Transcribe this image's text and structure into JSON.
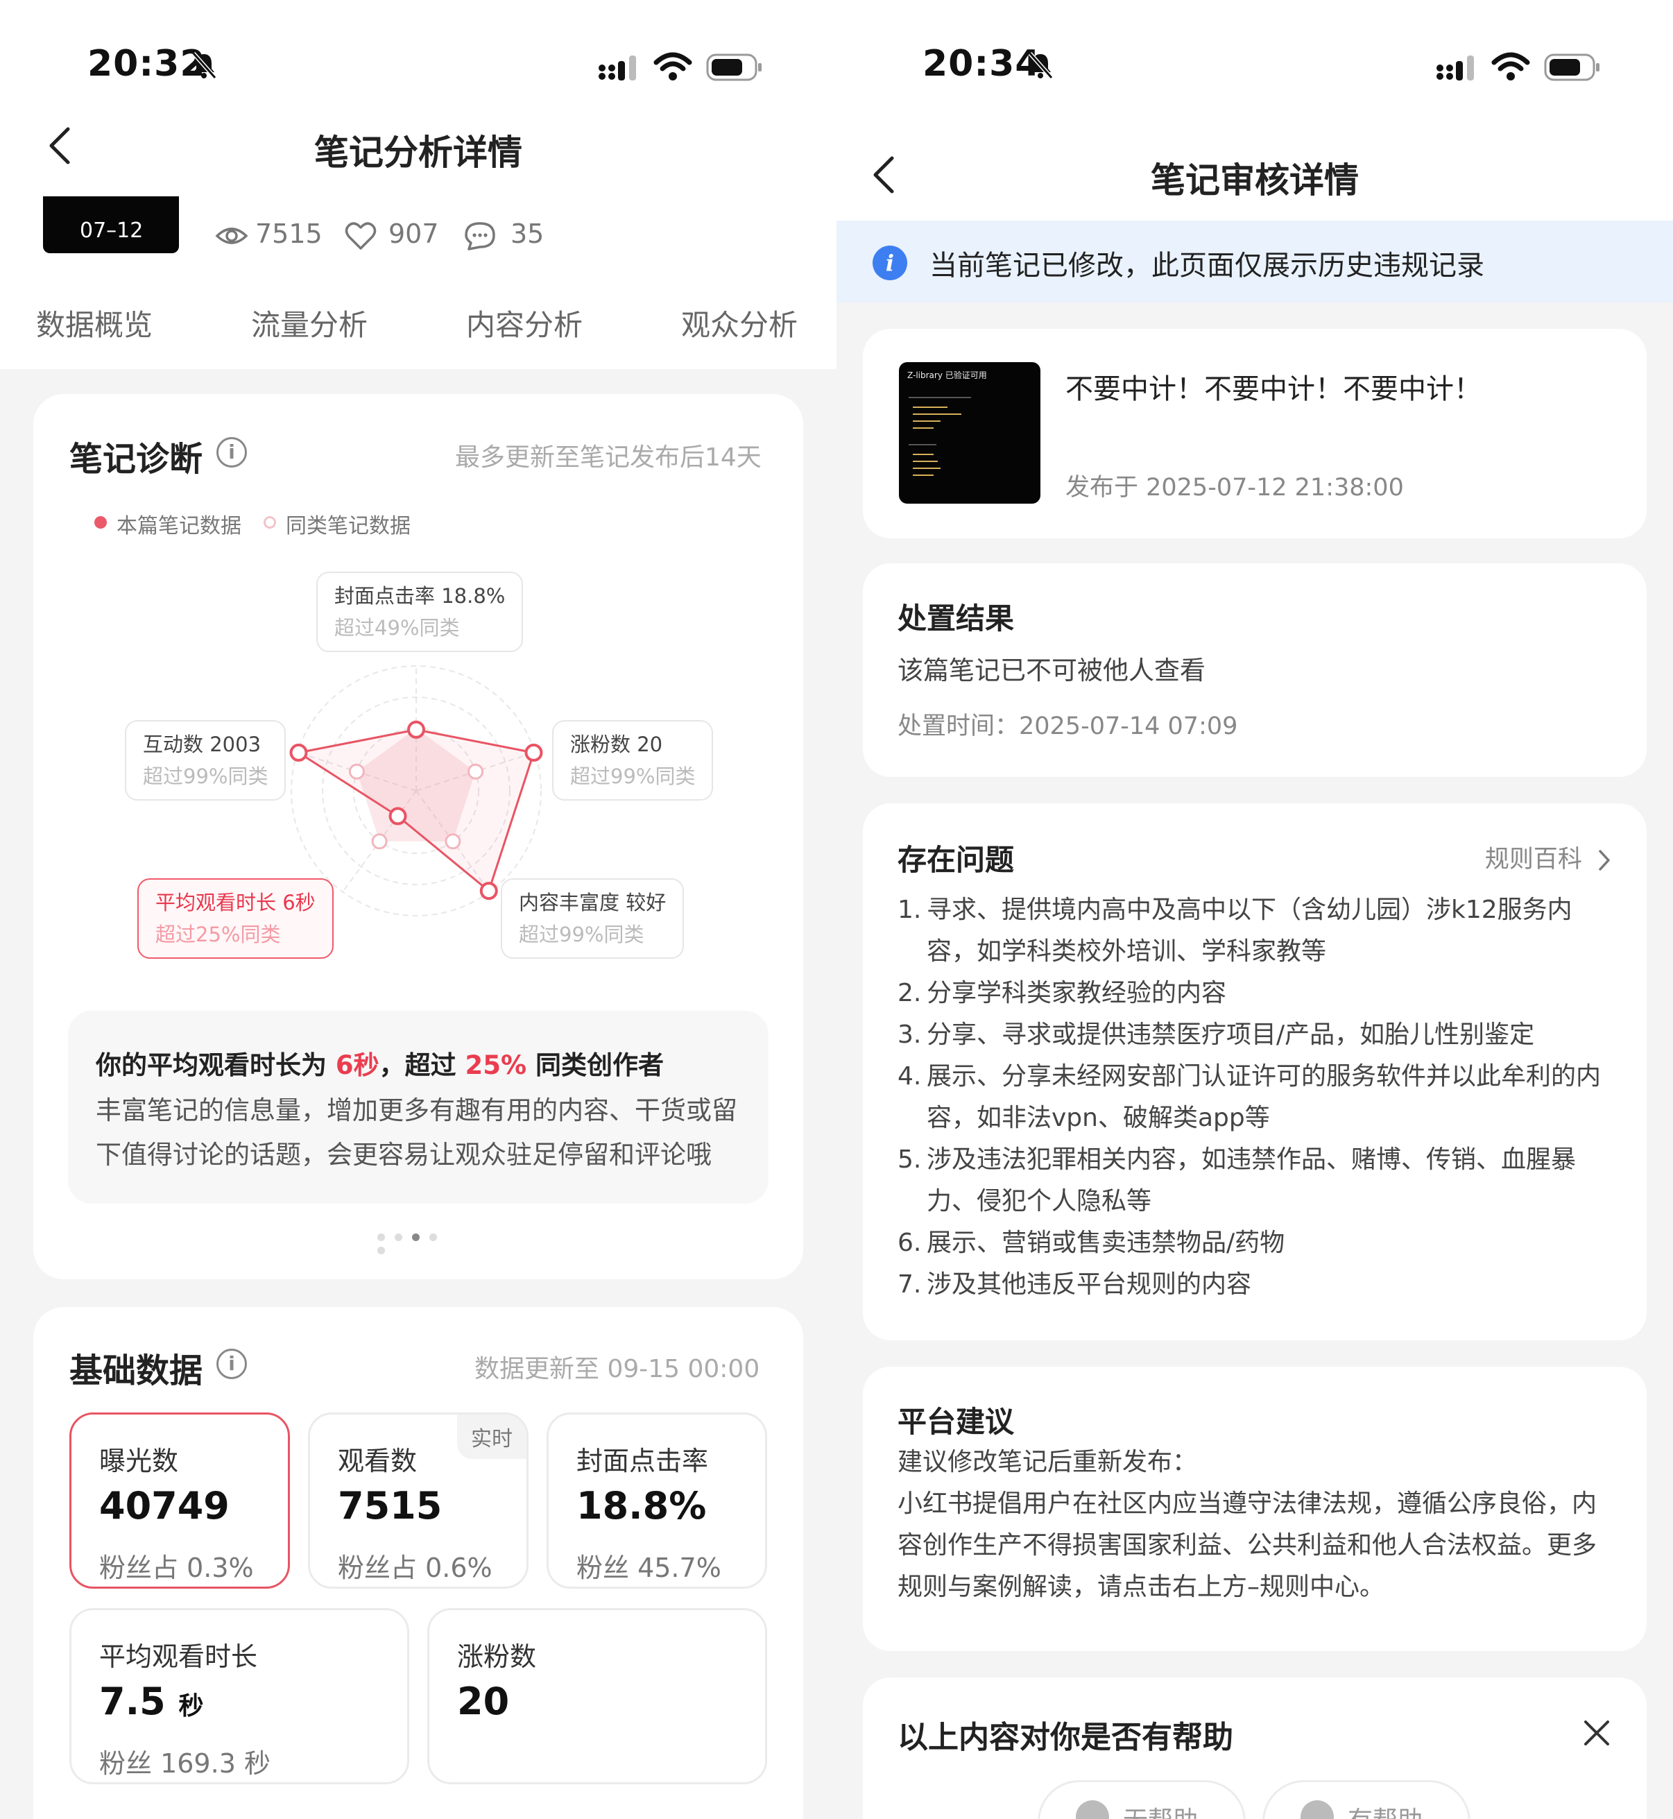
{
  "left": {
    "status": {
      "time": "20:32"
    },
    "header": {
      "title": "笔记分析详情"
    },
    "note": {
      "thumb_date": "07–12",
      "views": "7515",
      "likes": "907",
      "comments": "35"
    },
    "tabs": [
      "数据概览",
      "流量分析",
      "内容分析",
      "观众分析"
    ],
    "diagnosis": {
      "title": "笔记诊断",
      "note": "最多更新至笔记发布后14天",
      "legend": [
        "本篇笔记数据",
        "同类笔记数据"
      ],
      "labels": [
        {
          "name": "封面点击率 18.8%",
          "sub": "超过49%同类"
        },
        {
          "name": "涨粉数 20",
          "sub": "超过99%同类"
        },
        {
          "name": "内容丰富度 较好",
          "sub": "超过99%同类"
        },
        {
          "name": "平均观看时长 6秒",
          "sub": "超过25%同类"
        },
        {
          "name": "互动数 2003",
          "sub": "超过99%同类"
        }
      ],
      "radar": {
        "axes": [
          "封面点击率",
          "涨粉数",
          "内容丰富度",
          "平均观看时长",
          "互动数"
        ],
        "this_note": [
          0.49,
          0.99,
          0.99,
          0.25,
          0.99
        ],
        "peer": [
          0.5,
          0.5,
          0.5,
          0.5,
          0.5
        ]
      },
      "summary": {
        "prefix": "你的平均观看时长为 ",
        "value1": "6秒",
        "mid": "，超过 ",
        "value2": "25%",
        "suffix": " 同类创作者",
        "body": "丰富笔记的信息量，增加更多有趣有用的内容、干货或留下值得讨论的话题，会更容易让观众驻足停留和评论哦"
      },
      "page_dots": 5,
      "active_dot": 2
    },
    "basic": {
      "title": "基础数据",
      "note": "数据更新至 09-15 00:00",
      "metrics": [
        {
          "label": "曝光数",
          "value": "40749",
          "sub": "粉丝占 0.3%"
        },
        {
          "label": "观看数",
          "value": "7515",
          "sub": "粉丝占 0.6%",
          "badge": "实时"
        },
        {
          "label": "封面点击率",
          "value": "18.8%",
          "sub": "粉丝 45.7%"
        },
        {
          "label": "平均观看时长",
          "value": "7.5",
          "unit": "秒",
          "sub": "粉丝 169.3 秒"
        },
        {
          "label": "涨粉数",
          "value": "20",
          "sub": ""
        }
      ]
    }
  },
  "right": {
    "status": {
      "time": "20:34"
    },
    "header": {
      "title": "笔记审核详情"
    },
    "banner": "当前笔记已修改，此页面仅展示历史违规记录",
    "note": {
      "title": "不要中计！不要中计！不要中计！",
      "date": "发布于 2025-07-12 21:38:00",
      "thumb_text": "Z-library 已验证可用"
    },
    "result": {
      "title": "处置结果",
      "text": "该篇笔记已不可被他人查看",
      "time": "处置时间：2025-07-14 07:09"
    },
    "issues": {
      "title": "存在问题",
      "link": "规则百科",
      "items": [
        {
          "num": "1.",
          "text": "寻求、提供境内高中及高中以下（含幼儿园）涉k12服务内容，如学科类校外培训、学科家教等"
        },
        {
          "num": "2.",
          "text": "分享学科类家教经验的内容"
        },
        {
          "num": "3.",
          "text": "分享、寻求或提供违禁医疗项目/产品，如胎儿性别鉴定"
        },
        {
          "num": "4.",
          "text": "展示、分享未经网安部门认证许可的服务软件并以此牟利的内容，如非法vpn、破解类app等"
        },
        {
          "num": "5.",
          "text": "涉及违法犯罪相关内容，如违禁作品、赌博、传销、血腥暴力、侵犯个人隐私等"
        },
        {
          "num": "6.",
          "text": "展示、营销或售卖违禁物品/药物"
        },
        {
          "num": "7.",
          "text": "涉及其他违反平台规则的内容"
        }
      ]
    },
    "advice": {
      "title": "平台建议",
      "lead": "建议修改笔记后重新发布：",
      "body": "小红书提倡用户在社区内应当遵守法律法规，遵循公序良俗，内容创作生产不得损害国家利益、公共利益和他人合法权益。更多规则与案例解读，请点击右上方–规则中心。"
    },
    "feedback": {
      "title": "以上内容对你是否有帮助",
      "no": "无帮助",
      "yes": "有帮助"
    }
  },
  "colors": {
    "accent_red": "#ea3d4f",
    "info_blue": "#3d7ff1",
    "banner_bg": "#eaf2fd"
  }
}
